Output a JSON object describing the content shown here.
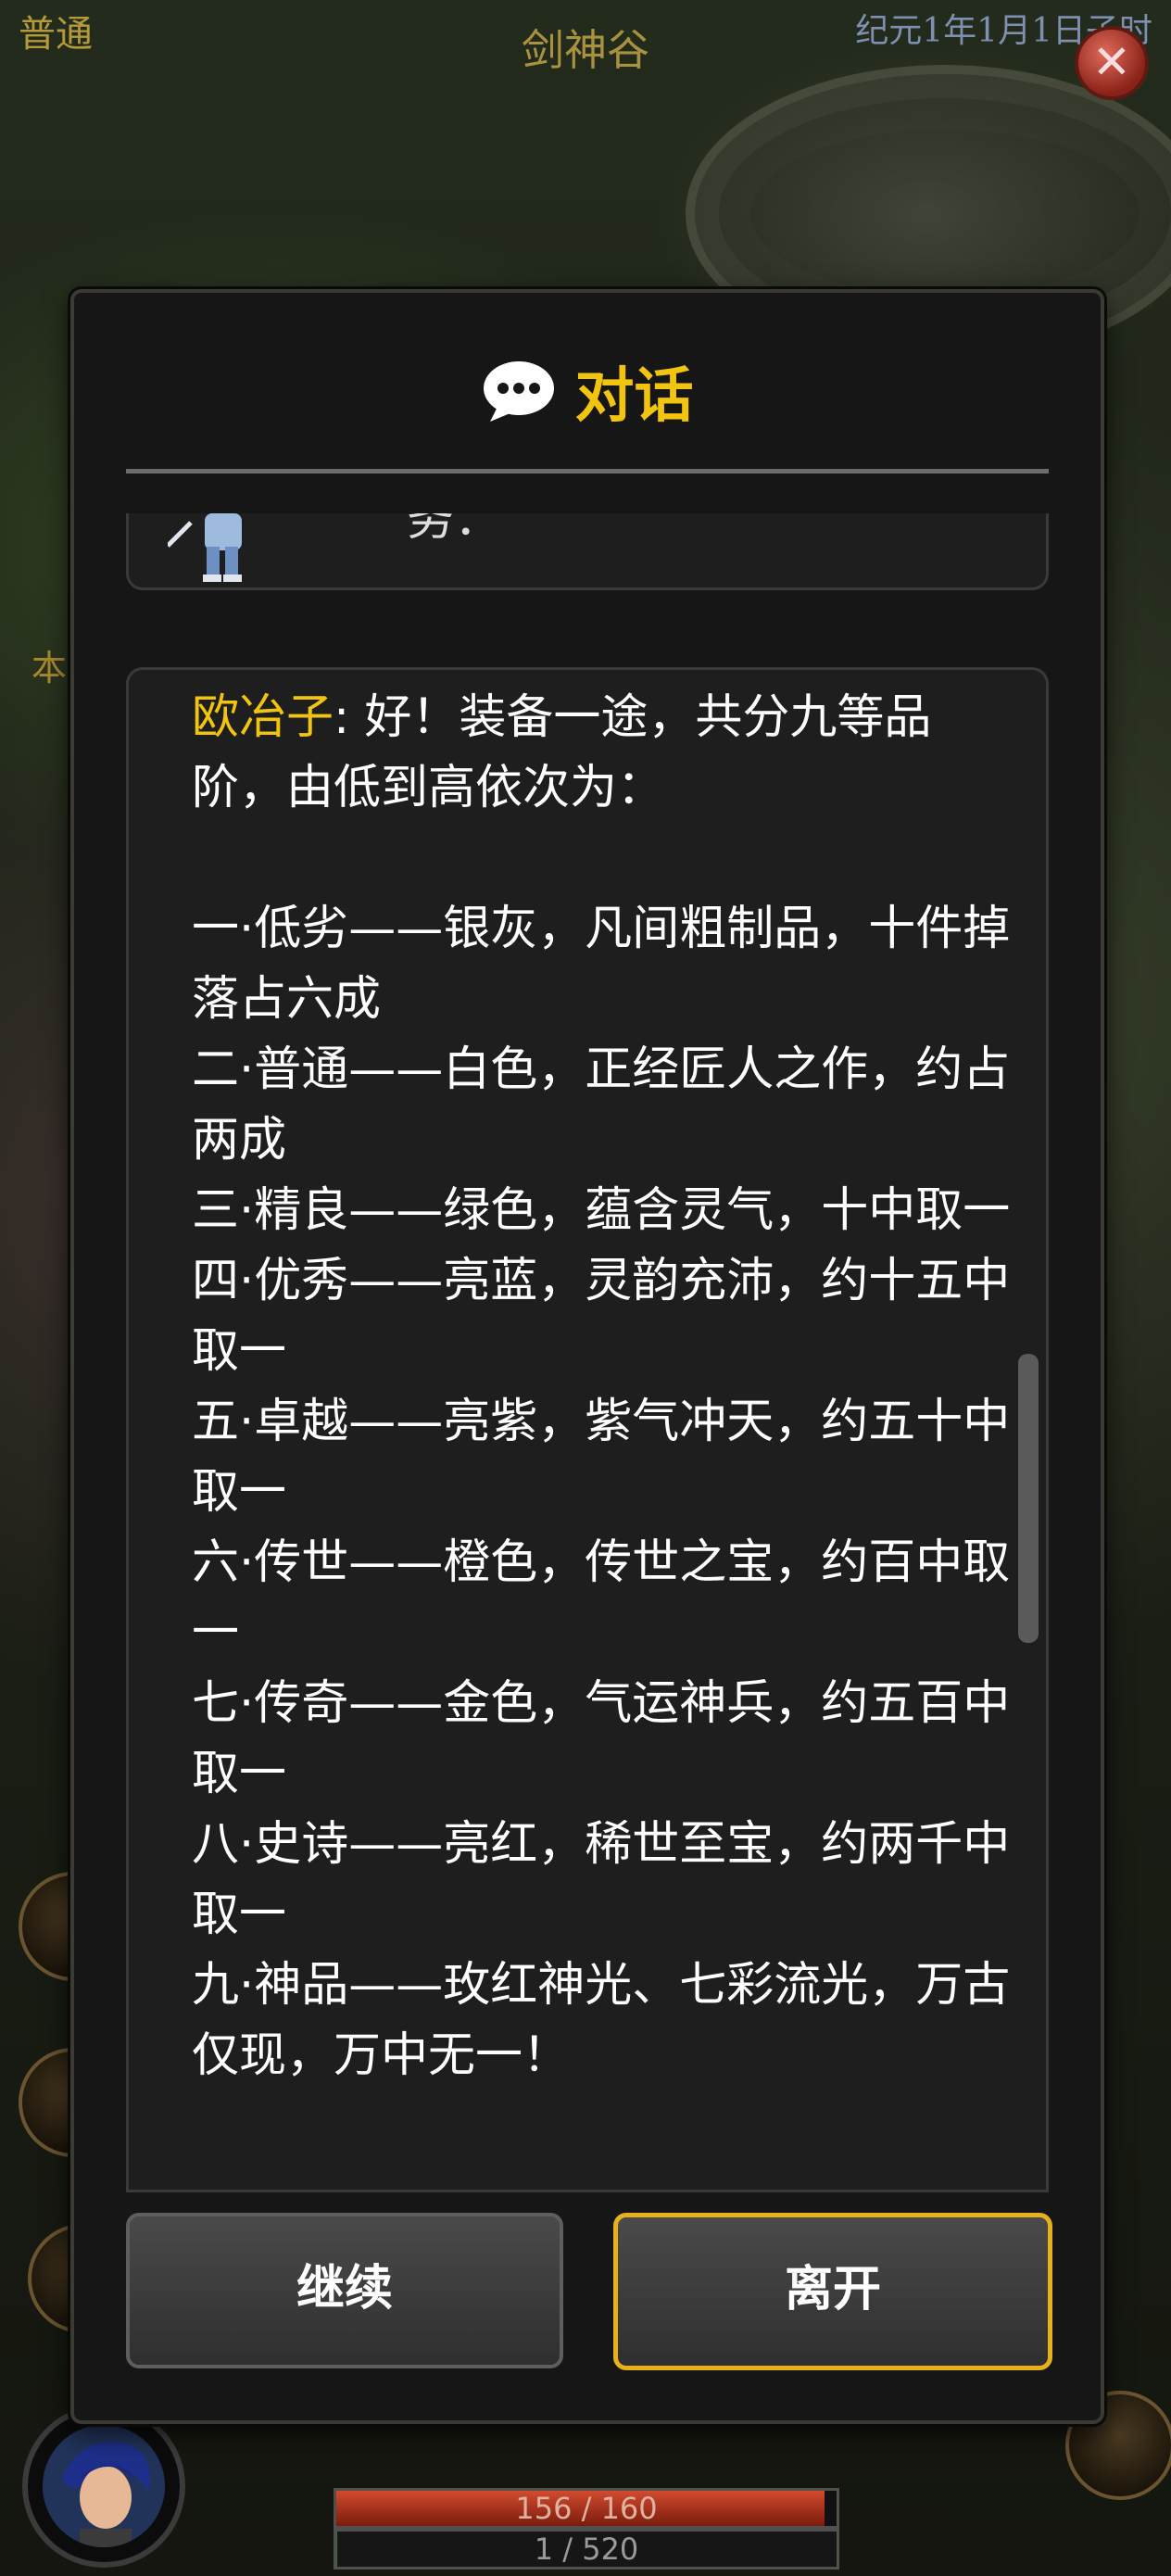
{
  "hud": {
    "mode": "普通",
    "location": "剑神谷",
    "datetime": "纪元1年1月1日子时",
    "side_char": "本",
    "hp_text": "156 / 160",
    "hp_fraction": 0.975,
    "exp_text": "1 / 520",
    "exp_fraction": 0.002
  },
  "dialog": {
    "title": "对话",
    "prev_text": "务：",
    "speaker": "欧冶子",
    "lines": [
      "好！装备一途，共分九等品",
      "阶，由低到高依次为：",
      "",
      "一·低劣——银灰，凡间粗制品，十件掉",
      "落占六成",
      "二·普通——白色，正经匠人之作，约占",
      "两成",
      "三·精良——绿色，蕴含灵气，十中取一",
      "四·优秀——亮蓝，灵韵充沛，约十五中",
      "取一",
      "五·卓越——亮紫，紫气冲天，约五十中",
      "取一",
      "六·传世——橙色，传世之宝，约百中取",
      "一",
      "七·传奇——金色，气运神兵，约五百中",
      "取一",
      "八·史诗——亮红，稀世至宝，约两千中",
      "取一",
      "九·神品——玫红神光、七彩流光，万古",
      "仅现，万中无一！"
    ],
    "continue_label": "继续",
    "leave_label": "离开"
  },
  "colors": {
    "accent_gold": "#f1c40f",
    "dialog_bg": "#161616",
    "hp_red": "#d24b2f"
  },
  "icons": {
    "title_icon": "speech-bubble-icon",
    "close": "close-icon"
  }
}
